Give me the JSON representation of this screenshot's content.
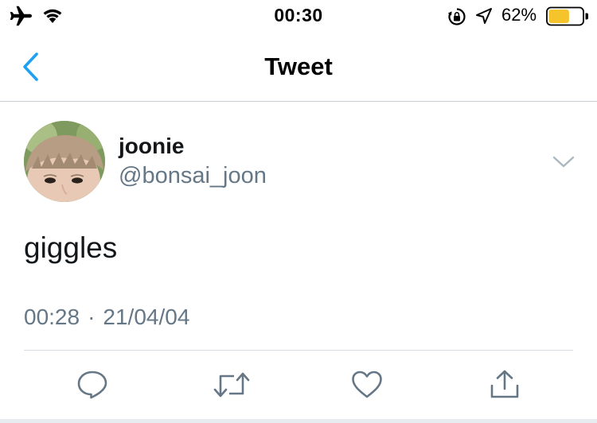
{
  "status_bar": {
    "time": "00:30",
    "battery_percent": "62%",
    "icons": [
      "airplane-icon",
      "wifi-icon",
      "orientation-lock-icon",
      "location-icon",
      "battery-icon"
    ],
    "battery_level": 0.62,
    "battery_color": "#f5c32c"
  },
  "nav": {
    "title": "Tweet",
    "back_icon": "chevron-left-icon",
    "accent_color": "#1da1f2"
  },
  "tweet": {
    "display_name": "joonie",
    "handle": "@bonsai_joon",
    "text": "giggles",
    "time": "00:28",
    "separator": "·",
    "date": "21/04/04"
  },
  "actions": [
    {
      "name": "reply",
      "icon": "reply-icon"
    },
    {
      "name": "retweet",
      "icon": "retweet-icon"
    },
    {
      "name": "like",
      "icon": "heart-icon"
    },
    {
      "name": "share",
      "icon": "share-icon"
    }
  ],
  "colors": {
    "text_primary": "#14171a",
    "text_secondary": "#657786",
    "icon_gray": "#657786",
    "divider": "#d8dde2"
  }
}
